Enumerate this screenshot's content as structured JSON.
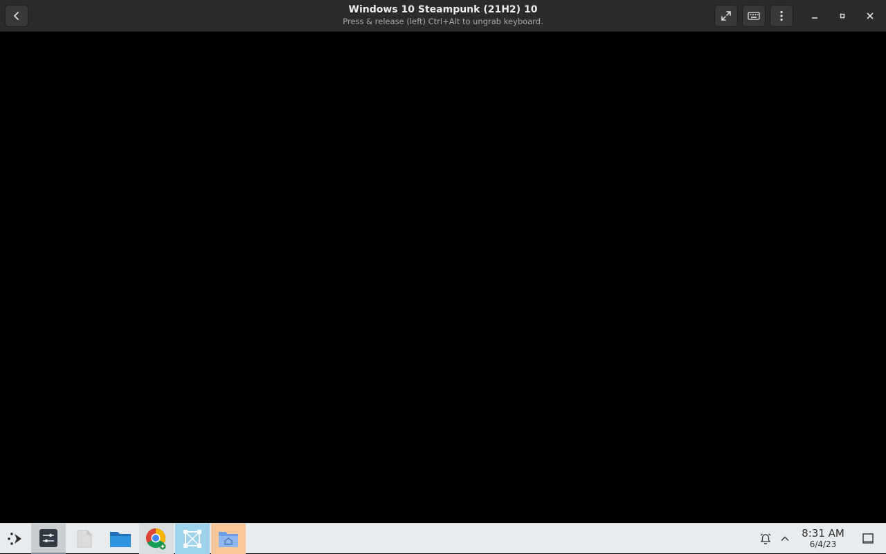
{
  "header": {
    "title": "Windows 10 Steampunk (21H2) 10",
    "subtitle": "Press & release (left) Ctrl+Alt to ungrab keyboard.",
    "back_icon": "chevron-left-icon",
    "fullscreen_icon": "fullscreen-icon",
    "keyboard_icon": "keyboard-icon",
    "menu_icon": "vertical-dots-icon",
    "window_controls": [
      "minimize-icon",
      "maximize-icon",
      "close-icon"
    ],
    "colors": {
      "bar": "#2b2b2b",
      "button": "#383838",
      "text": "#ededed",
      "subtext": "#a8a8a8"
    }
  },
  "display": {
    "background": "#000000"
  },
  "taskbar": {
    "apps": [
      {
        "name": "app-launcher",
        "icon": "launcher-icon"
      },
      {
        "name": "settings",
        "icon": "sliders-icon",
        "active": true
      },
      {
        "name": "text-editor",
        "icon": "blank-file-icon"
      },
      {
        "name": "file-manager",
        "icon": "folder-icon"
      },
      {
        "name": "chrome",
        "icon": "chrome-icon"
      },
      {
        "name": "boxes",
        "icon": "boxes-icon"
      },
      {
        "name": "home-folder",
        "icon": "home-folder-icon"
      }
    ],
    "tray": {
      "alarm_icon": "alarm-icon",
      "expand_icon": "chevron-up-icon",
      "time": "8:31 AM",
      "date": "6/4/23",
      "show_desktop_icon": "show-desktop-icon"
    },
    "colors": {
      "bar": "#e9ecee",
      "files_highlight": "#f7c79a",
      "boxes_highlight": "#9fd3ec"
    }
  }
}
